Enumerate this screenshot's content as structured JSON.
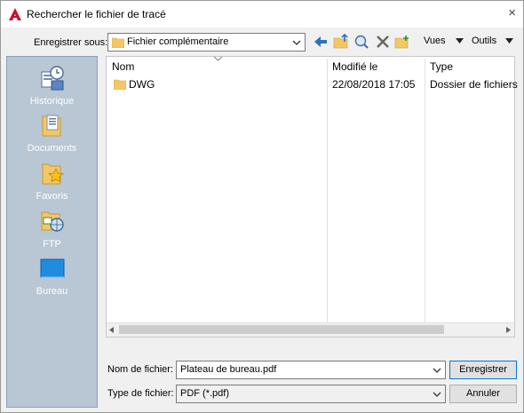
{
  "window": {
    "title": "Rechercher le fichier de tracé",
    "close": "×"
  },
  "toolbar": {
    "save_in_label": "Enregistrer sous:",
    "location": "Fichier complémentaire",
    "views_label": "Vues",
    "tools_label": "Outils"
  },
  "places": [
    {
      "label": "Historique",
      "icon": "history-icon"
    },
    {
      "label": "Documents",
      "icon": "documents-icon"
    },
    {
      "label": "Favoris",
      "icon": "favorites-icon"
    },
    {
      "label": "FTP",
      "icon": "ftp-icon"
    },
    {
      "label": "Bureau",
      "icon": "desktop-icon"
    }
  ],
  "file_list": {
    "columns": [
      "Nom",
      "Modifié le",
      "Type"
    ],
    "rows": [
      {
        "name": "DWG",
        "modified": "22/08/2018 17:05",
        "type": "Dossier de fichiers"
      }
    ]
  },
  "form": {
    "filename_label": "Nom de fichier:",
    "filename_value": "Plateau de bureau.pdf",
    "filetype_label": "Type de fichier:",
    "filetype_value": "PDF (*.pdf)",
    "save_button": "Enregistrer",
    "cancel_button": "Annuler"
  },
  "colors": {
    "places_bg": "#b9c6d4",
    "accent": "#0078d7",
    "autocad_red": "#c8102e",
    "folder": "#f3c767"
  }
}
